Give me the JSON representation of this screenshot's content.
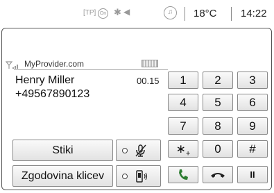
{
  "status_bar": {
    "tp": "[TP]",
    "on_badge": "On",
    "bluetooth_icon": "bluetooth-icon",
    "mute_icon": "speaker-mute-icon",
    "music_icon": "music-note-icon",
    "temperature": "18°C",
    "time": "14:22"
  },
  "call_info": {
    "provider": "MyProvider.com",
    "caller_name": "Henry Miller",
    "caller_number": "+49567890123",
    "duration": "00.15"
  },
  "buttons": {
    "contacts_label": "Stiki",
    "history_label": "Zgodovina klicev"
  },
  "keypad": {
    "k1": "1",
    "k2": "2",
    "k3": "3",
    "k4": "4",
    "k5": "5",
    "k6": "6",
    "k7": "7",
    "k8": "8",
    "k9": "9",
    "kstar": "∗",
    "kplus": "+",
    "k0": "0",
    "khash": "#",
    "pause": "II"
  },
  "colors": {
    "accept": "#2e7d32",
    "end_call": "#222222"
  }
}
